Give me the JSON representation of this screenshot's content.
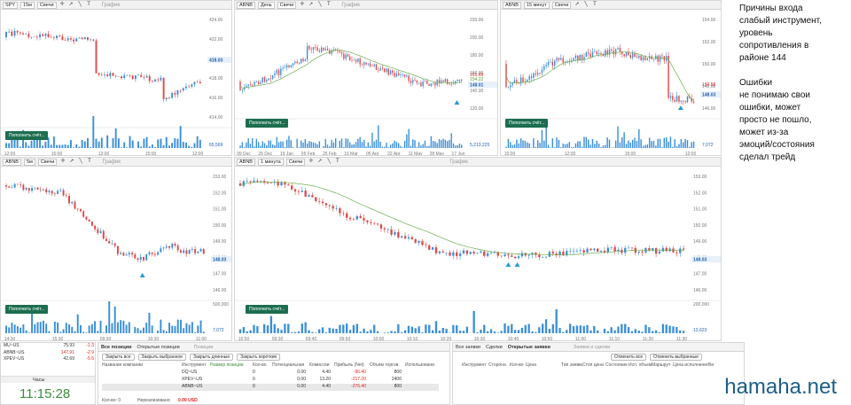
{
  "side_note": {
    "line1": "Причины входа",
    "line2": "слабый инструмент,",
    "line3": "уровень",
    "line4": "сопротивления в",
    "line5": "районе 144",
    "line6": "Ошибки",
    "line7": "не понимаю свои",
    "line8": "ошибки, может",
    "line9": "просто не пошло,",
    "line10": "может из-за",
    "line11": "эмоций/состояния",
    "line12": "сделал трейд"
  },
  "watermark": "hamaha.net",
  "common": {
    "chart_word": "График",
    "candles": "Свечи",
    "fund_btn": "Пополнить счёт..."
  },
  "charts": [
    {
      "ticker": "SPY",
      "interval": "15м",
      "price_label": "418.03",
      "vol_label": "65,569",
      "yticks": [
        "424.00",
        "422.00",
        "420.00",
        "418.00",
        "416.00",
        "414.00"
      ],
      "xticks": [
        "12:00",
        "15:00",
        "12:00",
        "15:00",
        "12:00"
      ]
    },
    {
      "ticker": "ABNB",
      "interval": "День",
      "price_label": "148.01",
      "extra_labels": [
        "161.68",
        "154.22"
      ],
      "vol_label": "5,213,225",
      "yticks": [
        "220.00",
        "200.00",
        "180.00",
        "160.00",
        "140.00",
        "120.00"
      ],
      "xticks": [
        "09 Dec",
        "29 Dec",
        "19 Jan",
        "05 Feb",
        "25 Feb",
        "16 Mar",
        "05 Apr",
        "22 Apr",
        "11 May",
        "28 May",
        "17 Jun"
      ]
    },
    {
      "ticker": "ABNB",
      "interval": "15 минут",
      "price_label": "148.03",
      "extra_labels": [
        "150.58"
      ],
      "vol_label": "7,072",
      "yticks": [
        "154.00",
        "152.00",
        "150.00",
        "148.00",
        "146.00"
      ],
      "xticks": [
        "15:00",
        "12:00",
        "15:00",
        "12:00"
      ]
    },
    {
      "ticker": "ABNB",
      "interval": "5м",
      "price_label": "148.03",
      "vol_label": "7,072",
      "vol_top": "500,000",
      "yticks": [
        "153.00",
        "152.00",
        "151.00",
        "150.00",
        "149.00",
        "148.00",
        "147.00",
        "146.00"
      ],
      "xticks": [
        "14:30",
        "15:30",
        "09:30",
        "10:30",
        "11:00"
      ]
    },
    {
      "ticker": "ABNB",
      "interval": "1 минута",
      "price_label": "148.03",
      "vol_label": "13,623",
      "vol_top": "200,000",
      "yticks": [
        "153.00",
        "152.00",
        "151.00",
        "150.00",
        "149.00",
        "148.00",
        "147.00",
        "146.00"
      ],
      "xticks": [
        "15:50",
        "09:30",
        "09:40",
        "09:50",
        "10:00",
        "10:10",
        "10:20",
        "10:30",
        "10:40",
        "10:50",
        "11:00",
        "11:10",
        "11:20",
        "11:30"
      ]
    }
  ],
  "quotes": {
    "rows": [
      {
        "sym": "MU~US",
        "last": "75.93",
        "chg": "-1.3"
      },
      {
        "sym": "ABNB~US",
        "last": "147.91",
        "chg": "-2.9"
      },
      {
        "sym": "XPEV~US",
        "last": "42.69",
        "chg": "-5.6"
      }
    ],
    "clock_label": "Часы",
    "clock": "11:15:28"
  },
  "positions": {
    "tab_all": "Все позиции",
    "tab_open": "Открытые позиции",
    "title": "Позиции",
    "buttons": [
      "Закрыть все",
      "Закрыть выбранное",
      "Закрыть длинные",
      "Закрыть короткие"
    ],
    "headers": [
      "Название компании",
      "Инструмент",
      "Размер позиции",
      "Кол-во",
      "Потенциальная",
      "Комиссии",
      "Прибыль (Net)",
      "Объем торгов",
      "Использовани"
    ],
    "rows": [
      {
        "inst": "DQ~US",
        "qty": "0",
        "pot": "0.00",
        "com": "4.40",
        "pnl": "-96.40",
        "vol": "800"
      },
      {
        "inst": "XPEV~US",
        "qty": "0",
        "pot": "0.00",
        "com": "13.20",
        "pnl": "-217.20",
        "vol": "2400"
      },
      {
        "inst": "ABNB~US",
        "qty": "0",
        "pot": "0.00",
        "com": "4.40",
        "pnl": "-276.40",
        "vol": "800"
      }
    ],
    "footer_qty": "Кол-во: 0",
    "footer_unreal": "Нереализовано:",
    "footer_val": "0.00 USD"
  },
  "orders": {
    "tabs": [
      "Все заявки",
      "Сделки",
      "Открытые заявки"
    ],
    "title": "Заявки и сделки",
    "buttons": [
      "Отменить все",
      "Отменить выбранные"
    ],
    "headers": [
      "Инструмент",
      "Сторона",
      "Кол-во",
      "Цена",
      "Тип заявки",
      "Стоп цена",
      "Состояние",
      "Исп. объем",
      "Маршрут",
      "Цена исполнения",
      "Ви"
    ]
  }
}
